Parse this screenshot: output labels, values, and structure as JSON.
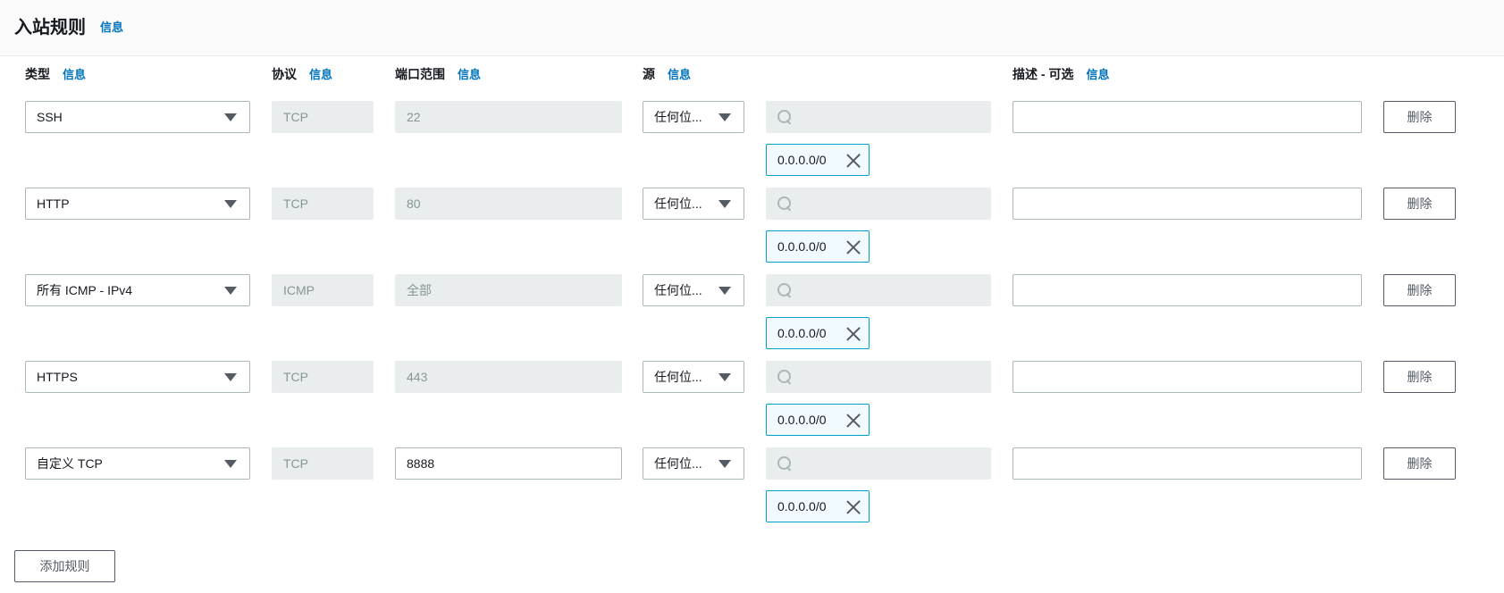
{
  "header": {
    "title": "入站规则",
    "info": "信息"
  },
  "columns": {
    "type": {
      "label": "类型",
      "info": "信息"
    },
    "protocol": {
      "label": "协议",
      "info": "信息"
    },
    "port_range": {
      "label": "端口范围",
      "info": "信息"
    },
    "source": {
      "label": "源",
      "info": "信息"
    },
    "description": {
      "label": "描述 - 可选",
      "info": "信息"
    }
  },
  "rules": [
    {
      "type": "SSH",
      "protocol": "TCP",
      "port": "22",
      "port_editable": false,
      "source_type": "任何位...",
      "search_placeholder": "",
      "cidr": "0.0.0.0/0",
      "description": "",
      "delete_label": "删除"
    },
    {
      "type": "HTTP",
      "protocol": "TCP",
      "port": "80",
      "port_editable": false,
      "source_type": "任何位...",
      "search_placeholder": "",
      "cidr": "0.0.0.0/0",
      "description": "",
      "delete_label": "删除"
    },
    {
      "type": "所有 ICMP - IPv4",
      "protocol": "ICMP",
      "port": "全部",
      "port_editable": false,
      "source_type": "任何位...",
      "search_placeholder": "",
      "cidr": "0.0.0.0/0",
      "description": "",
      "delete_label": "删除"
    },
    {
      "type": "HTTPS",
      "protocol": "TCP",
      "port": "443",
      "port_editable": false,
      "source_type": "任何位...",
      "search_placeholder": "",
      "cidr": "0.0.0.0/0",
      "description": "",
      "delete_label": "删除"
    },
    {
      "type": "自定义 TCP",
      "protocol": "TCP",
      "port": "8888",
      "port_editable": true,
      "source_type": "任何位...",
      "search_placeholder": "",
      "cidr": "0.0.0.0/0",
      "description": "",
      "delete_label": "删除"
    }
  ],
  "add_rule_label": "添加规则",
  "colors": {
    "link": "#0073bb",
    "token_border": "#00a1c9",
    "disabled_bg": "#eaeded"
  }
}
